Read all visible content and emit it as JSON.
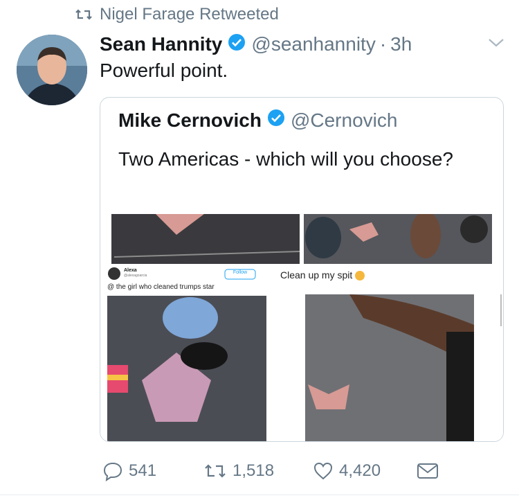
{
  "retweet": {
    "text": "Nigel Farage Retweeted"
  },
  "tweet": {
    "author_name": "Sean Hannity",
    "handle": "@seanhannity",
    "separator": "·",
    "time": "3h",
    "text": "Powerful point."
  },
  "quoted": {
    "author_name": "Mike Cernovich",
    "handle": "@Cernovich",
    "text": "Two Americas - which will you choose?",
    "embedded": {
      "user_name": "Alexa",
      "user_handle": "@alexagoarcia",
      "follow_label": "Follow",
      "caption": "@ the girl who cleaned trumps star",
      "right_caption": "Clean up my spit"
    }
  },
  "actions": {
    "replies": "541",
    "retweets": "1,518",
    "likes": "4,420"
  },
  "colors": {
    "verified": "#1da1f2",
    "muted": "#657786",
    "border": "#ccd6dd"
  }
}
